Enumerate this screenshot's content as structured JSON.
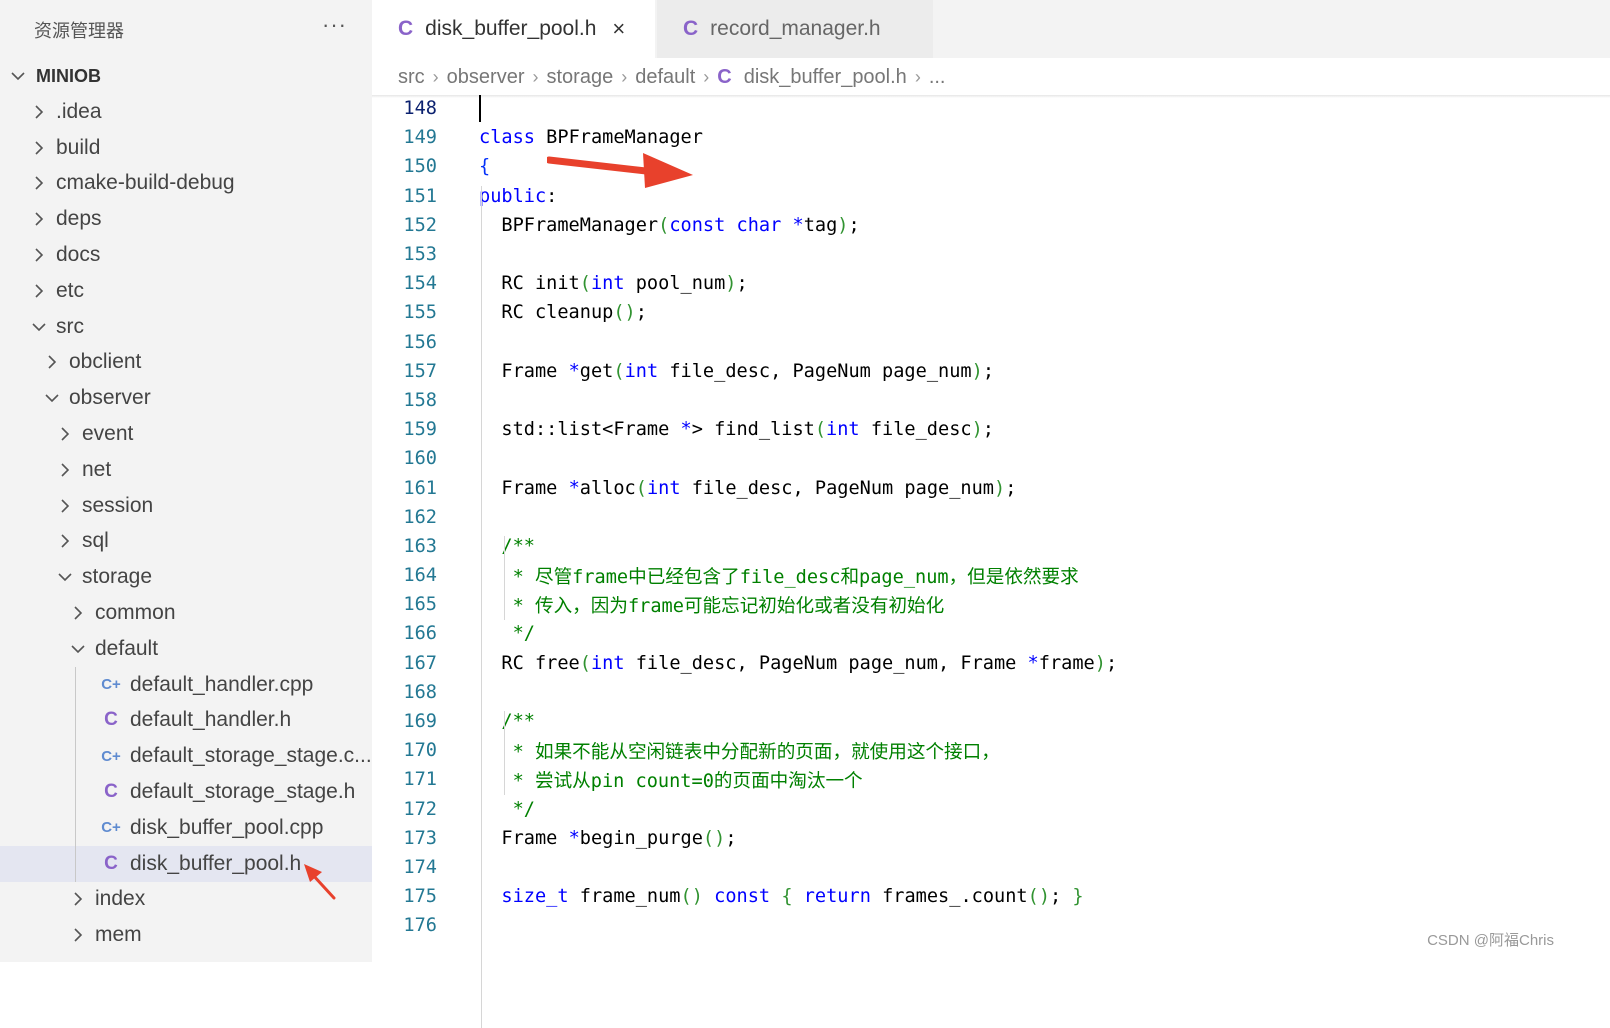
{
  "sidebar": {
    "title": "资源管理器",
    "more": "···",
    "root": "MINIOB",
    "items": [
      {
        "label": ".idea",
        "depth": 0,
        "kind": "folder",
        "open": false
      },
      {
        "label": "build",
        "depth": 0,
        "kind": "folder",
        "open": false
      },
      {
        "label": "cmake-build-debug",
        "depth": 0,
        "kind": "folder",
        "open": false
      },
      {
        "label": "deps",
        "depth": 0,
        "kind": "folder",
        "open": false
      },
      {
        "label": "docs",
        "depth": 0,
        "kind": "folder",
        "open": false
      },
      {
        "label": "etc",
        "depth": 0,
        "kind": "folder",
        "open": false
      },
      {
        "label": "src",
        "depth": 0,
        "kind": "folder",
        "open": true
      },
      {
        "label": "obclient",
        "depth": 1,
        "kind": "folder",
        "open": false
      },
      {
        "label": "observer",
        "depth": 1,
        "kind": "folder",
        "open": true
      },
      {
        "label": "event",
        "depth": 2,
        "kind": "folder",
        "open": false
      },
      {
        "label": "net",
        "depth": 2,
        "kind": "folder",
        "open": false
      },
      {
        "label": "session",
        "depth": 2,
        "kind": "folder",
        "open": false
      },
      {
        "label": "sql",
        "depth": 2,
        "kind": "folder",
        "open": false
      },
      {
        "label": "storage",
        "depth": 2,
        "kind": "folder",
        "open": true
      },
      {
        "label": "common",
        "depth": 3,
        "kind": "folder",
        "open": false
      },
      {
        "label": "default",
        "depth": 3,
        "kind": "folder",
        "open": true
      },
      {
        "label": "default_handler.cpp",
        "depth": 4,
        "kind": "cpp"
      },
      {
        "label": "default_handler.h",
        "depth": 4,
        "kind": "h"
      },
      {
        "label": "default_storage_stage.c...",
        "depth": 4,
        "kind": "cpp"
      },
      {
        "label": "default_storage_stage.h",
        "depth": 4,
        "kind": "h"
      },
      {
        "label": "disk_buffer_pool.cpp",
        "depth": 4,
        "kind": "cpp"
      },
      {
        "label": "disk_buffer_pool.h",
        "depth": 4,
        "kind": "h",
        "selected": true
      },
      {
        "label": "index",
        "depth": 3,
        "kind": "folder",
        "open": false
      },
      {
        "label": "mem",
        "depth": 3,
        "kind": "folder",
        "open": false
      }
    ]
  },
  "tabs": [
    {
      "icon": "C",
      "label": "disk_buffer_pool.h",
      "close": "×"
    },
    {
      "icon": "C",
      "label": "record_manager.h"
    }
  ],
  "breadcrumb": [
    "src",
    "observer",
    "storage",
    "default",
    "disk_buffer_pool.h",
    "..."
  ],
  "breadcrumb_icon": "C",
  "icon_h": "C",
  "icon_cpp": "C+",
  "code": {
    "lines": [
      {
        "n": "148",
        "t": ""
      },
      {
        "n": "149",
        "t": "class BPFrameManager"
      },
      {
        "n": "150",
        "t": "{"
      },
      {
        "n": "151",
        "t": "public:"
      },
      {
        "n": "152",
        "t": "  BPFrameManager(const char *tag);"
      },
      {
        "n": "153",
        "t": ""
      },
      {
        "n": "154",
        "t": "  RC init(int pool_num);"
      },
      {
        "n": "155",
        "t": "  RC cleanup();"
      },
      {
        "n": "156",
        "t": ""
      },
      {
        "n": "157",
        "t": "  Frame *get(int file_desc, PageNum page_num);"
      },
      {
        "n": "158",
        "t": ""
      },
      {
        "n": "159",
        "t": "  std::list<Frame *> find_list(int file_desc);"
      },
      {
        "n": "160",
        "t": ""
      },
      {
        "n": "161",
        "t": "  Frame *alloc(int file_desc, PageNum page_num);"
      },
      {
        "n": "162",
        "t": ""
      },
      {
        "n": "163",
        "t": "  /**"
      },
      {
        "n": "164",
        "t": "   * 尽管frame中已经包含了file_desc和page_num，但是依然要求"
      },
      {
        "n": "165",
        "t": "   * 传入，因为frame可能忘记初始化或者没有初始化"
      },
      {
        "n": "166",
        "t": "   */"
      },
      {
        "n": "167",
        "t": "  RC free(int file_desc, PageNum page_num, Frame *frame);"
      },
      {
        "n": "168",
        "t": ""
      },
      {
        "n": "169",
        "t": "  /**"
      },
      {
        "n": "170",
        "t": "   * 如果不能从空闲链表中分配新的页面，就使用这个接口，"
      },
      {
        "n": "171",
        "t": "   * 尝试从pin count=0的页面中淘汰一个"
      },
      {
        "n": "172",
        "t": "   */"
      },
      {
        "n": "173",
        "t": "  Frame *begin_purge();"
      },
      {
        "n": "174",
        "t": ""
      },
      {
        "n": "175",
        "t": "  size_t frame_num() const { return frames_.count(); }"
      },
      {
        "n": "176",
        "t": ""
      }
    ]
  },
  "watermark": "CSDN @阿福Chris",
  "colors": {
    "keyword": "#0000ff",
    "comment": "#008000",
    "line_number": "#237893",
    "annotation_arrow": "#e8412c",
    "sidebar_bg": "#f3f3f3",
    "selected_bg": "#e4e6f1"
  }
}
